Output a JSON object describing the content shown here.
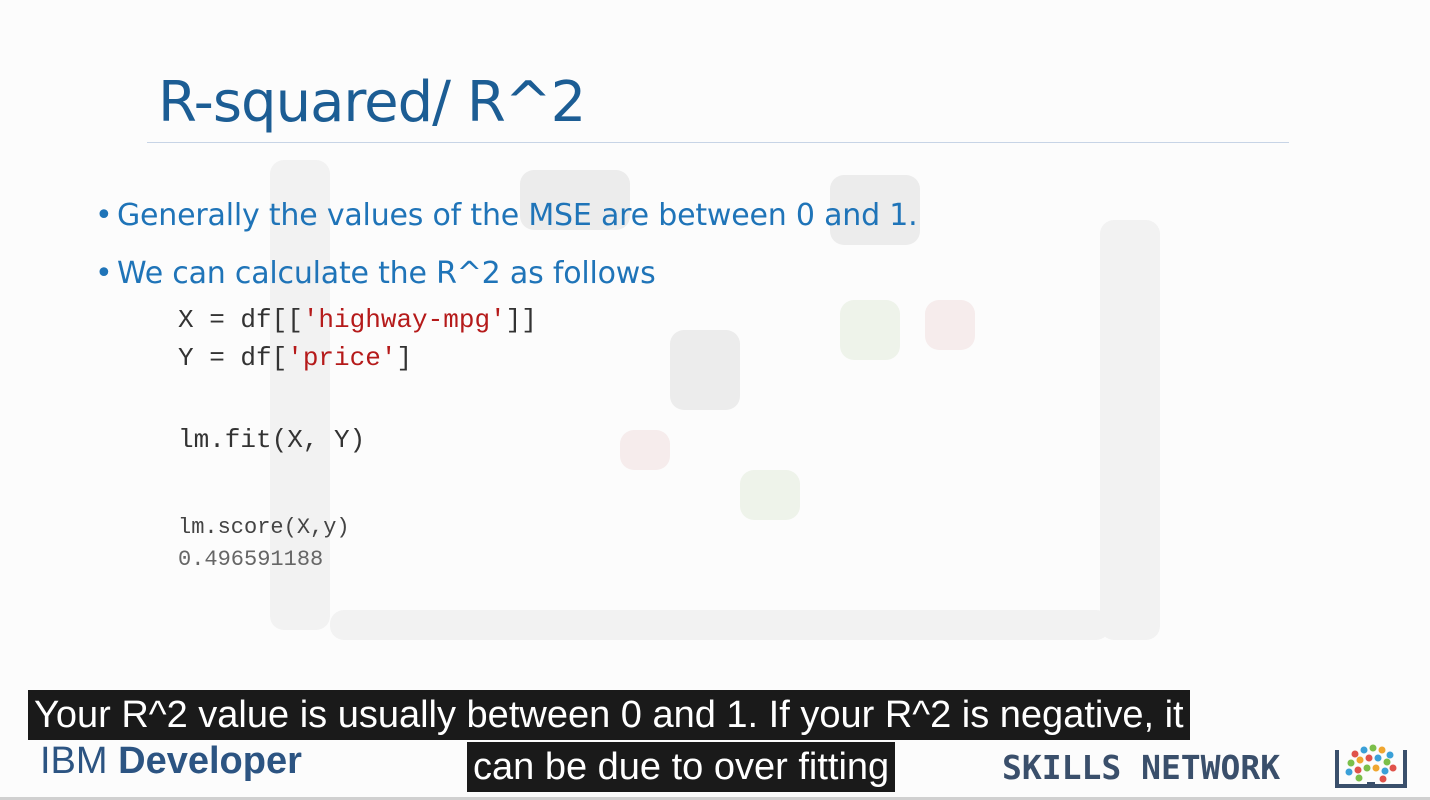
{
  "slide": {
    "title": "R-squared/ R^2",
    "bullets": [
      "Generally the values of the MSE are between 0 and 1.",
      "We can calculate the R^2 as follows"
    ],
    "code": {
      "line1_prefix": "X = df[[",
      "line1_str": "'highway-mpg'",
      "line1_suffix": "]]",
      "line2_prefix": "Y = df[",
      "line2_str": "'price'",
      "line2_suffix": "]",
      "fit": "lm.fit(X, Y)",
      "score": "lm.score(X,y)",
      "score_result": "0.496591188"
    }
  },
  "caption": {
    "line1": "Your R^2 value is usually between 0 and 1. If your R^2 is negative, it",
    "line2": "can be due to over fitting"
  },
  "footer": {
    "brand_left_light": "IBM",
    "brand_left_bold": "Developer",
    "brand_right": "SKILLS NETWORK",
    "logo_icon": "skills-network-book-icon"
  },
  "colors": {
    "title": "#1c5d94",
    "bullet": "#1f74b8",
    "string": "#b51a1a",
    "caption_bg": "#1a1a1a"
  }
}
